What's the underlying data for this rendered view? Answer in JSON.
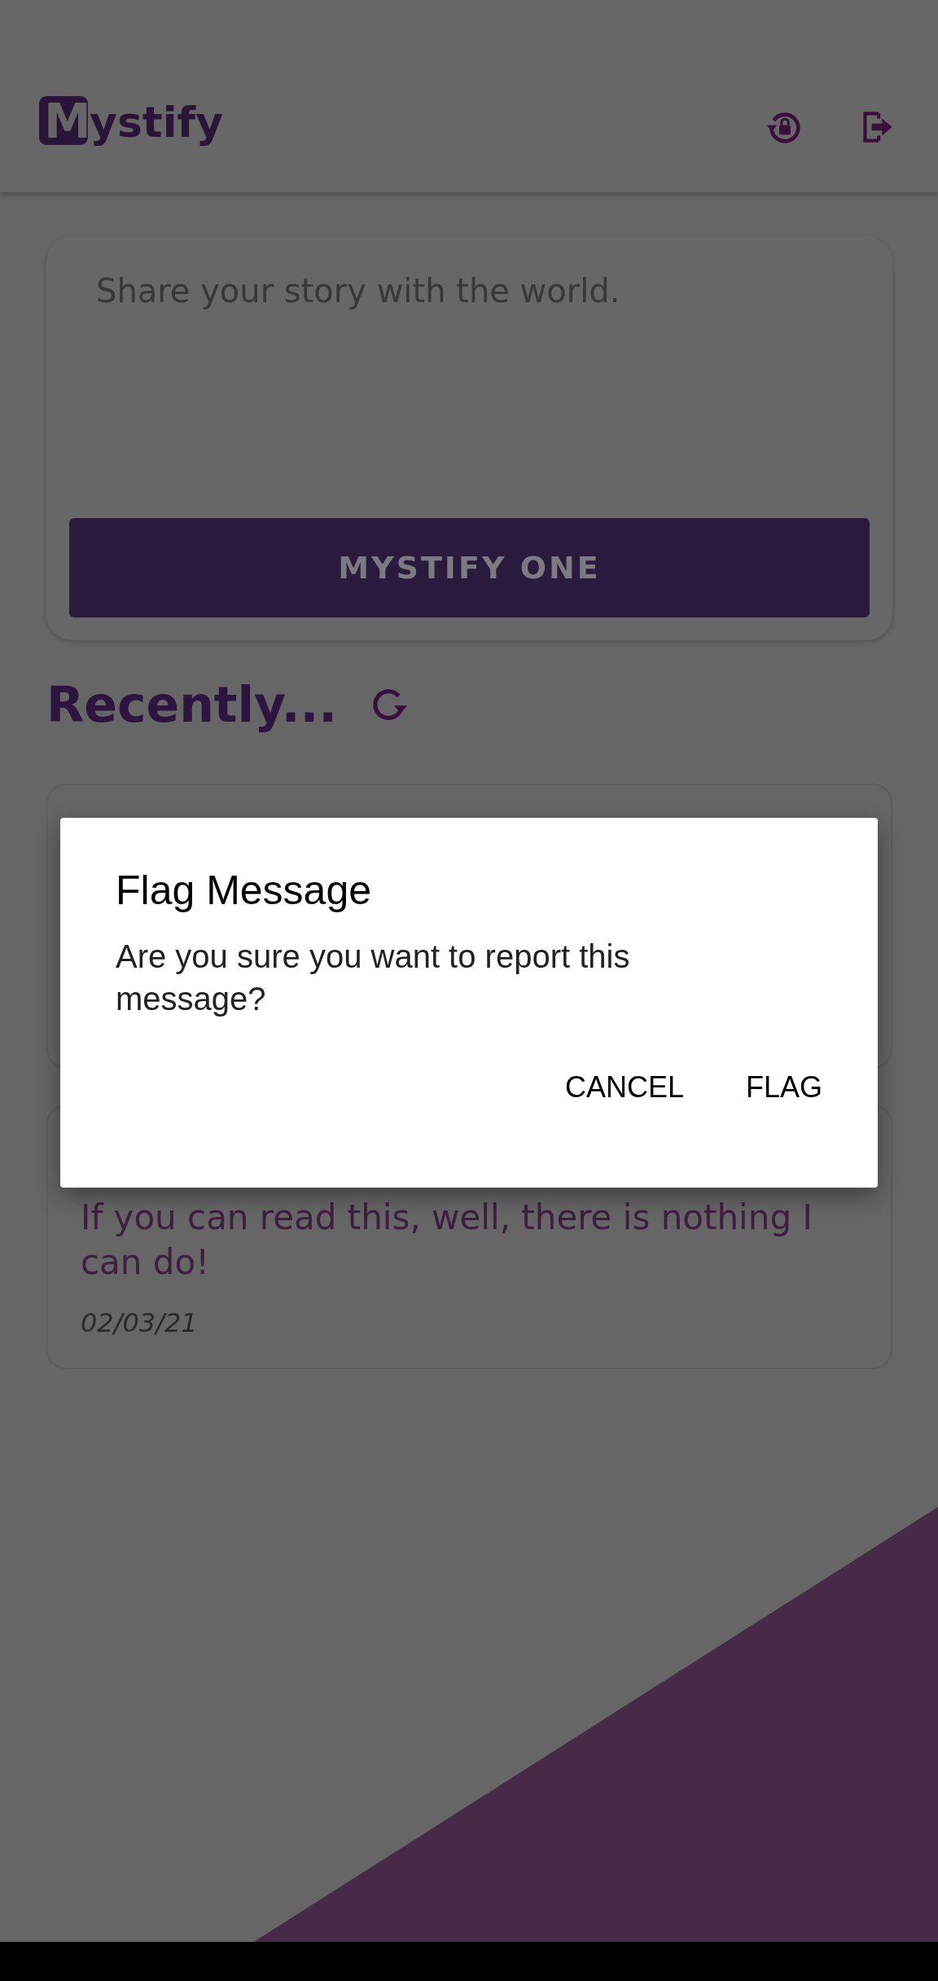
{
  "app_bar": {
    "logo_letter": "M",
    "logo_rest": "ystify"
  },
  "composer": {
    "placeholder": "Share your story with the world.",
    "button": "MYSTIFY ONE"
  },
  "feed": {
    "heading": "Recently...",
    "posts": [
      {
        "kind": "hidden"
      },
      {
        "kind": "visible",
        "text": "If you can read this, well, there is nothing I can do!",
        "date": "02/03/21"
      }
    ]
  },
  "dialog": {
    "title": "Flag Message",
    "message": "Are you sure you want to report this message?",
    "buttons": [
      "CANCEL",
      "FLAG"
    ]
  }
}
